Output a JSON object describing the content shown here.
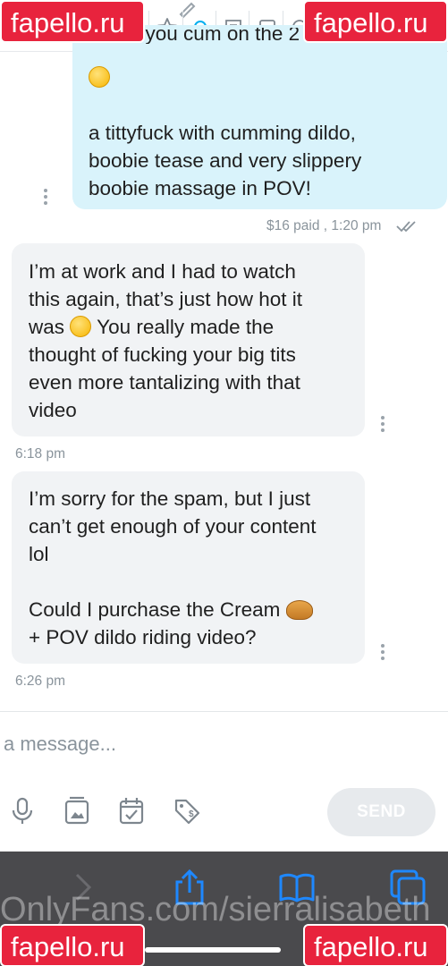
{
  "toolbar": {
    "title_fragment": "on",
    "icons": [
      "pencil-icon",
      "star-icon",
      "bell-icon",
      "sticky-note-icon",
      "image-icon",
      "search-icon"
    ]
  },
  "watermark": {
    "site": "fapello.ru",
    "url": "OnlyFans.com/sierralisabeth"
  },
  "messages": [
    {
      "direction": "outgoing",
      "clipped_first_line": "made you cum on the 2 times...",
      "emoji": "smirking-face",
      "lines": [
        "a tittyfuck with cumming dildo,",
        "boobie tease and very slippery",
        "boobie massage in POV!"
      ],
      "meta": "$16 paid , 1:20 pm"
    },
    {
      "direction": "incoming",
      "lines": [
        "I’m at work and I had to watch",
        "this again, that’s just how hot it",
        "was",
        "You really made the",
        "thought of fucking your big tits",
        "even more tantalizing with that",
        "video"
      ],
      "emoji": "face-with-steam",
      "time": "6:18 pm"
    },
    {
      "direction": "incoming",
      "lines": [
        "I’m sorry for the spam, but I just",
        "can’t get enough of your content",
        "lol",
        "Could I purchase the Cream",
        "+ POV dildo riding video?"
      ],
      "emoji": "pie",
      "time": "6:26 pm"
    }
  ],
  "composer": {
    "placeholder": "a message...",
    "send_label": "SEND",
    "actions": [
      "microphone-icon",
      "media-vault-icon",
      "calendar-check-icon",
      "price-tag-icon"
    ]
  },
  "colors": {
    "outgoing_bubble": "#d9f3fb",
    "incoming_bubble": "#f1f3f5",
    "accent": "#00aff0",
    "watermark": "#e8233d",
    "browser_bar": "#4a4a4d"
  }
}
